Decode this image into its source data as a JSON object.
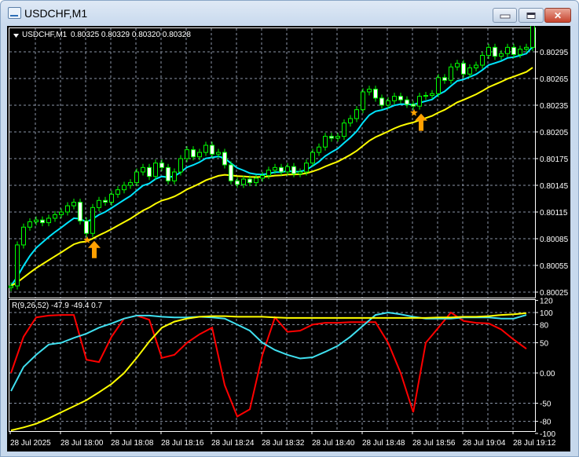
{
  "window": {
    "title": "USDCHF,M1",
    "icon": "chart-window-icon",
    "buttons": [
      "minimize",
      "maximize",
      "close"
    ]
  },
  "colors": {
    "background": "#000000",
    "grid": "#8c96a8",
    "candle": "#00ff00",
    "bear_body": "#ffffff",
    "bull_body": "#000000",
    "ma_fast": "#00e5ff",
    "ma_slow": "#ffff00",
    "osc_red": "#ff0000",
    "osc_cyan": "#40e0f0",
    "osc_yellow": "#ffff00",
    "signal": "#ffa000"
  },
  "chart_data": [
    {
      "type": "candlestick",
      "header": "USDCHF,M1",
      "ohlc_text": "0.80325 0.80329 0.80320 0.80328",
      "y_ticks": [
        "0.80295",
        "0.80265",
        "0.80235",
        "0.80205",
        "0.80175",
        "0.80145",
        "0.80115",
        "0.80085",
        "0.80055",
        "0.80025"
      ],
      "ylim": [
        0.80022,
        0.80334
      ],
      "x_ticks": [
        "28 Jul 2025",
        "28 Jul 18:00",
        "28 Jul 18:08",
        "28 Jul 18:16",
        "28 Jul 18:24",
        "28 Jul 18:32",
        "28 Jul 18:40",
        "28 Jul 18:48",
        "28 Jul 18:56",
        "28 Jul 19:04",
        "28 Jul 19:12"
      ],
      "first_open": 0.8003,
      "closes": [
        0.80032,
        0.80078,
        0.80098,
        0.80104,
        0.80106,
        0.80103,
        0.80108,
        0.80112,
        0.80115,
        0.80122,
        0.80126,
        0.80105,
        0.80091,
        0.8012,
        0.80128,
        0.80126,
        0.80135,
        0.8014,
        0.80145,
        0.80148,
        0.8016,
        0.80165,
        0.80155,
        0.8017,
        0.80165,
        0.8015,
        0.8016,
        0.80175,
        0.80185,
        0.80177,
        0.80182,
        0.8019,
        0.8018,
        0.80182,
        0.80168,
        0.8015,
        0.80146,
        0.80152,
        0.80148,
        0.80153,
        0.80156,
        0.80162,
        0.80165,
        0.8016,
        0.80166,
        0.80158,
        0.8016,
        0.8017,
        0.80182,
        0.80188,
        0.802,
        0.80198,
        0.802,
        0.80215,
        0.8022,
        0.8023,
        0.8025,
        0.80253,
        0.80243,
        0.80235,
        0.8024,
        0.80245,
        0.80241,
        0.80236,
        0.80234,
        0.80245,
        0.80246,
        0.80248,
        0.80266,
        0.80263,
        0.80278,
        0.80282,
        0.8027,
        0.80277,
        0.8028,
        0.80291,
        0.803,
        0.8029,
        0.80293,
        0.803,
        0.80292,
        0.80298,
        0.803,
        0.80328
      ],
      "signals": [
        {
          "type": "buy",
          "candle": 12
        },
        {
          "type": "buy",
          "candle": 64
        }
      ]
    },
    {
      "type": "line",
      "label": "R(9,26,52) -47.9 -49.4 0.7",
      "y_ticks": [
        "120",
        "100",
        "80",
        "50",
        "0.00",
        "-50",
        "-80",
        "-100"
      ],
      "ylim": [
        -100,
        120
      ],
      "step_candles": 2,
      "series": [
        {
          "color": "#ff0000",
          "values": [
            0,
            60,
            92,
            95,
            96,
            96,
            22,
            18,
            60,
            90,
            95,
            88,
            25,
            30,
            50,
            64,
            75,
            -20,
            -72,
            -60,
            30,
            92,
            68,
            70,
            80,
            83,
            83,
            84,
            84,
            84,
            50,
            0,
            -65,
            50,
            75,
            100,
            86,
            83,
            82,
            72,
            55,
            40
          ]
        },
        {
          "color": "#40e0f0",
          "values": [
            -30,
            10,
            30,
            47,
            50,
            58,
            65,
            75,
            82,
            90,
            95,
            95,
            93,
            92,
            92,
            93,
            92,
            90,
            80,
            70,
            50,
            38,
            30,
            24,
            26,
            35,
            45,
            60,
            78,
            96,
            100,
            97,
            93,
            90,
            90,
            90,
            92,
            92,
            92,
            90,
            90,
            96
          ]
        },
        {
          "color": "#ffff00",
          "values": [
            -95,
            -90,
            -84,
            -75,
            -65,
            -55,
            -45,
            -32,
            -18,
            0,
            25,
            52,
            75,
            85,
            90,
            93,
            94,
            94,
            93,
            93,
            93,
            92,
            91,
            91,
            91,
            91,
            91,
            91,
            91,
            91,
            91,
            91,
            91,
            91,
            92,
            92,
            93,
            93,
            94,
            96,
            97,
            99
          ]
        }
      ]
    }
  ]
}
